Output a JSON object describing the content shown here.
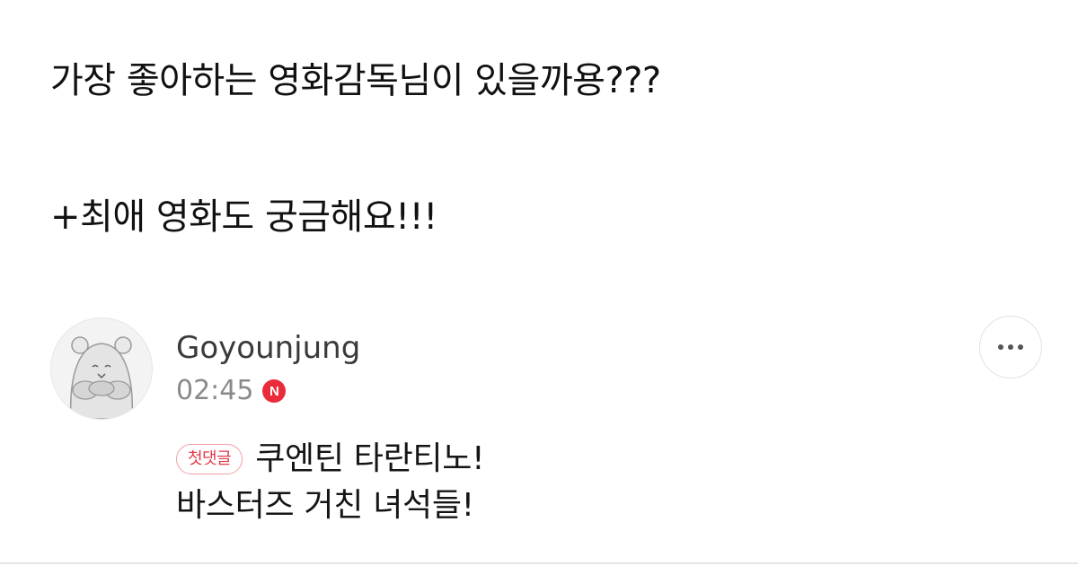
{
  "post": {
    "lines": [
      "가장 좋아하는 영화감독님이 있을까용???",
      "+최애 영화도 궁금해요!!!"
    ]
  },
  "comment": {
    "author": "Goyounjung",
    "time": "02:45",
    "new_badge": "N",
    "first_comment_badge": "첫댓글",
    "body_lines": [
      "쿠엔틴 타란티노!",
      "바스터즈 거친 녀석들!"
    ],
    "avatar_icon": "hamster-avatar-icon",
    "more_icon": "more-horizontal-icon"
  },
  "colors": {
    "text": "#111111",
    "author": "#3a3a3a",
    "meta": "#8a8a8a",
    "new_badge": "#ea2b3b",
    "first_comment": "#e23a48",
    "divider": "#e6e6e6"
  }
}
